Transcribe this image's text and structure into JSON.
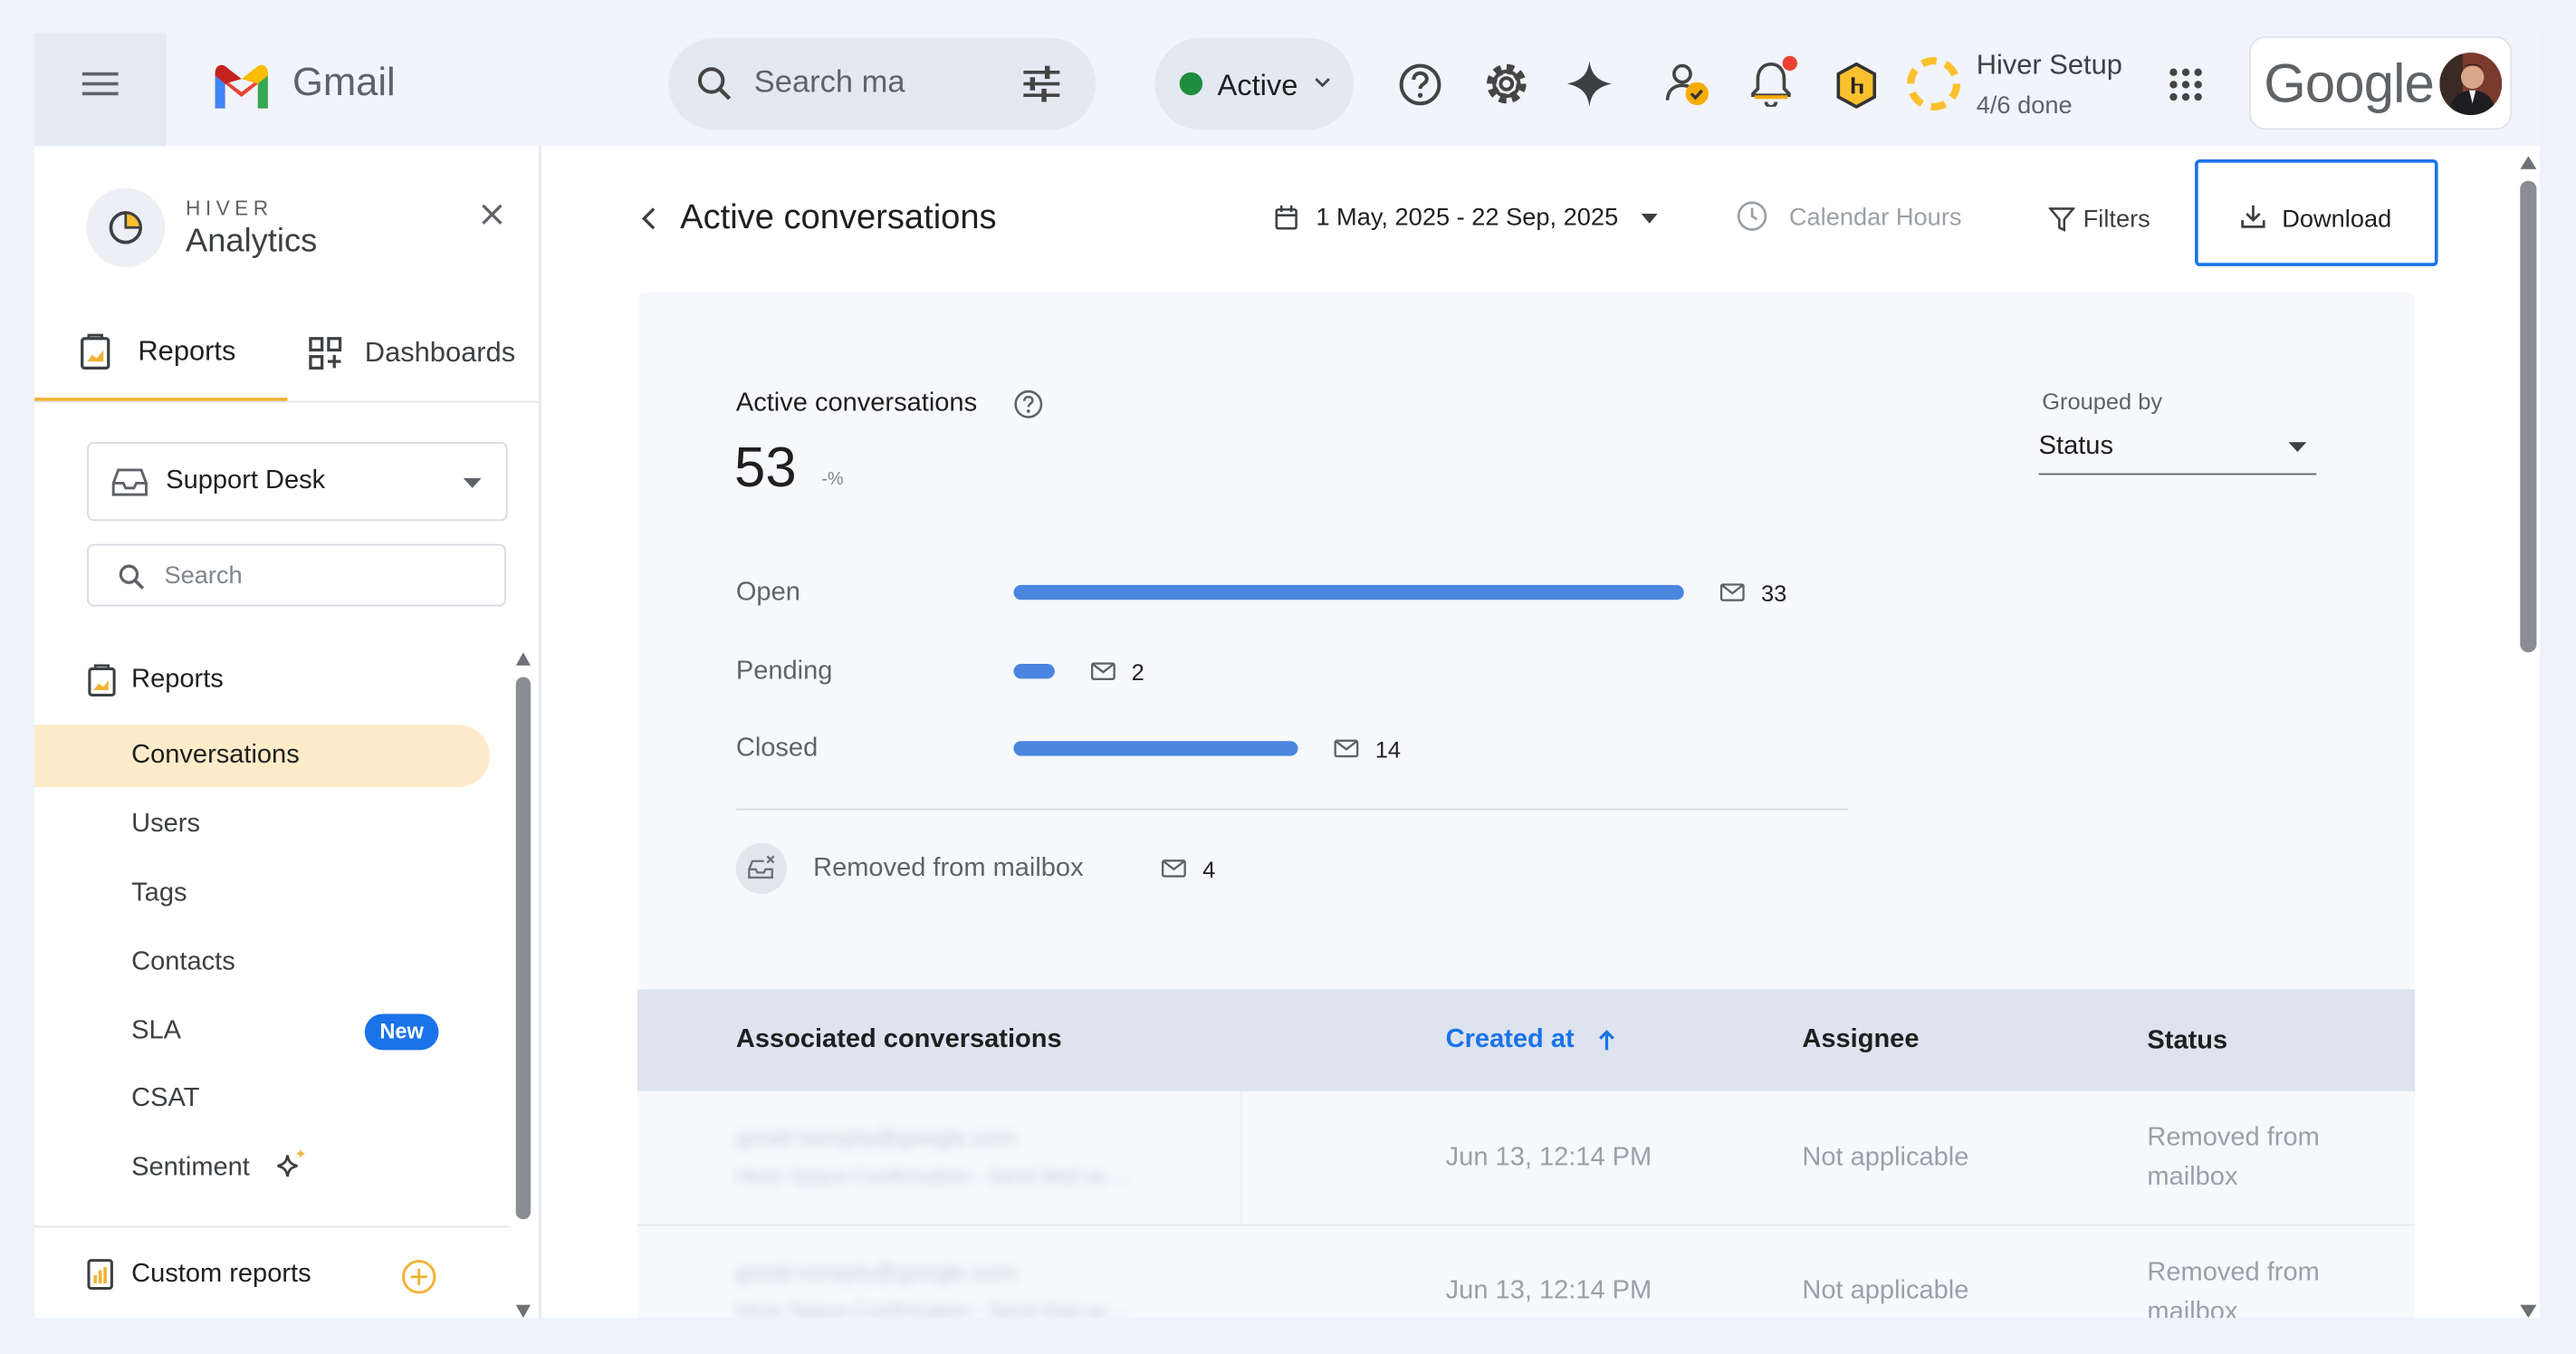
{
  "topbar": {
    "app_name": "Gmail",
    "search_placeholder": "Search ma",
    "status_label": "Active",
    "setup_title": "Hiver Setup",
    "setup_progress": "4/6 done",
    "google_label": "Google",
    "status_color": "#1e8e3e"
  },
  "sidebar": {
    "brand_small": "HIVER",
    "brand_title": "Analytics",
    "tabs": [
      {
        "label": "Reports"
      },
      {
        "label": "Dashboards"
      }
    ],
    "inbox_select": "Support Desk",
    "search_placeholder": "Search",
    "reports_header": "Reports",
    "items": [
      {
        "label": "Conversations"
      },
      {
        "label": "Users"
      },
      {
        "label": "Tags"
      },
      {
        "label": "Contacts"
      },
      {
        "label": "SLA",
        "badge": "New"
      },
      {
        "label": "CSAT"
      },
      {
        "label": "Sentiment"
      }
    ],
    "custom_reports": "Custom reports"
  },
  "header": {
    "title": "Active conversations",
    "date_range": "1 May, 2025 - 22 Sep, 2025",
    "calendar_hours": "Calendar Hours",
    "filters": "Filters",
    "download": "Download"
  },
  "summary": {
    "label": "Active conversations",
    "total": "53",
    "change": "-%",
    "grouped_by_label": "Grouped by",
    "grouped_by_value": "Status",
    "removed_label": "Removed from mailbox",
    "removed_count": "4"
  },
  "chart_data": {
    "type": "bar",
    "categories": [
      "Open",
      "Pending",
      "Closed"
    ],
    "values": [
      33,
      2,
      14
    ]
  },
  "table": {
    "headers": [
      "Associated conversations",
      "Created at",
      "Assignee",
      "Status"
    ],
    "sort_color": "#1a73e8",
    "rows": [
      {
        "from": "gmail-noreply@google.com",
        "subject": "Hiver Space Confirmation - Send Mail as ...",
        "created": "Jun 13, 12:14 PM",
        "assignee": "Not applicable",
        "status_line1": "Removed from",
        "status_line2": "mailbox"
      },
      {
        "from": "gmail-noreply@google.com",
        "subject": "Hiver Space Confirmation - Send Mail as ...",
        "created": "Jun 13, 12:14 PM",
        "assignee": "Not applicable",
        "status_line1": "Removed from",
        "status_line2": "mailbox"
      }
    ]
  }
}
